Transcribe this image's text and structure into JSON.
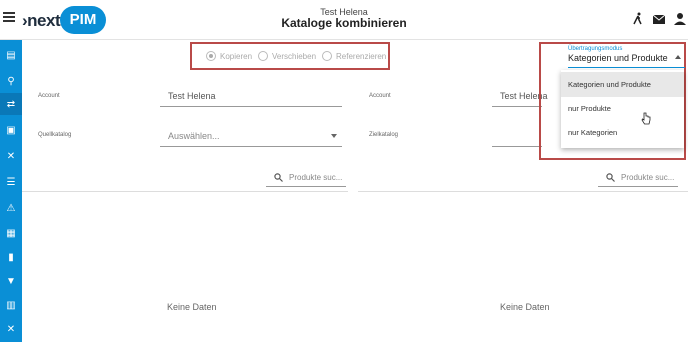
{
  "header": {
    "user": "Test Helena",
    "title": "Kataloge kombinieren",
    "logo_left": "›next",
    "logo_right": "PIM"
  },
  "sidebar": {
    "items": [
      "catalog-icon",
      "search-icon",
      "transfer-icon",
      "document-icon",
      "shuffle-icon",
      "list-icon",
      "warning-icon",
      "calculator-icon",
      "bar-chart-icon",
      "filter-icon",
      "print-icon",
      "shuffle-icon"
    ]
  },
  "radios": {
    "copy": "Kopieren",
    "move": "Verschieben",
    "reference": "Referenzieren"
  },
  "left": {
    "account_label": "Account",
    "account_value": "Test Helena",
    "catalog_label": "Quellkatalog",
    "catalog_placeholder": "Auswählen...",
    "search_placeholder": "Produkte suc...",
    "empty": "Keine Daten"
  },
  "right": {
    "account_label": "Account",
    "account_value": "Test Helena",
    "catalog_label": "Zielkatalog",
    "search_placeholder": "Produkte suc...",
    "empty": "Keine Daten"
  },
  "mode": {
    "label": "Übertragungsmodus",
    "value": "Kategorien und Produkte",
    "options": [
      "Kategorien und Produkte",
      "nur Produkte",
      "nur Kategorien"
    ]
  },
  "colors": {
    "accent": "#0a8fd6",
    "highlight_border": "#b94a48"
  }
}
